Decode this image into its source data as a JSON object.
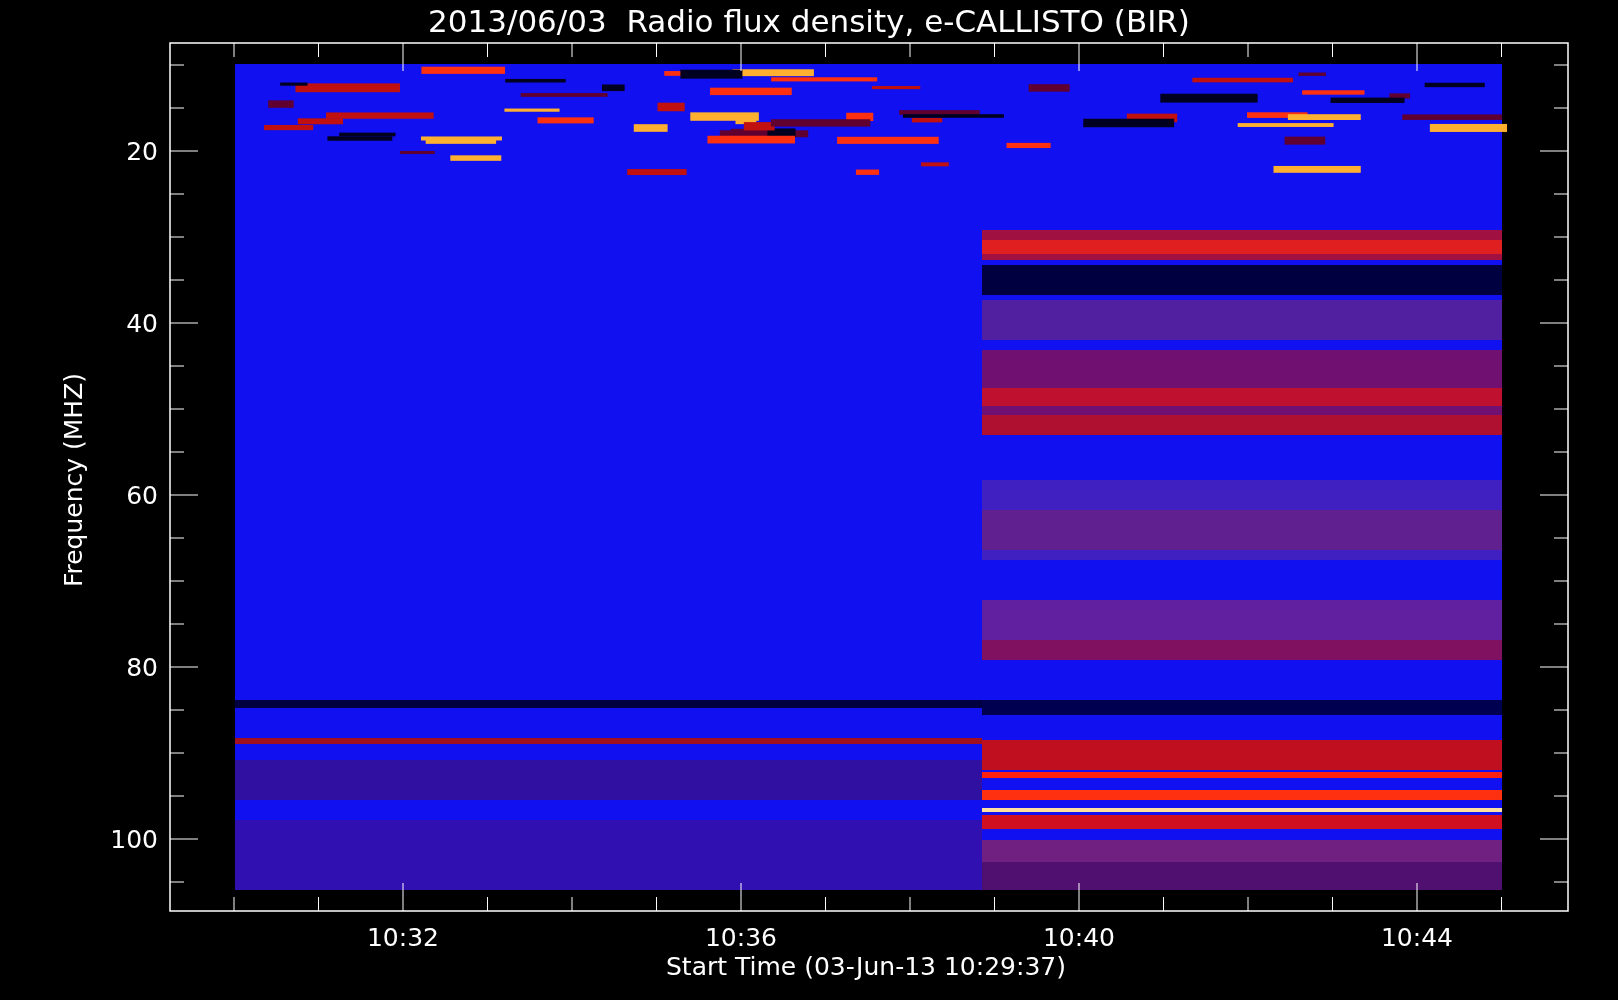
{
  "title": "2013/06/03  Radio flux density, e-CALLISTO (BIR)",
  "y_axis": {
    "label": "Frequency (MHZ)",
    "ticks": [
      "20",
      "40",
      "60",
      "80",
      "100"
    ]
  },
  "x_axis": {
    "label": "Start Time (03-Jun-13 10:29:37)",
    "ticks": [
      "10:32",
      "10:36",
      "10:40",
      "10:44"
    ]
  }
}
